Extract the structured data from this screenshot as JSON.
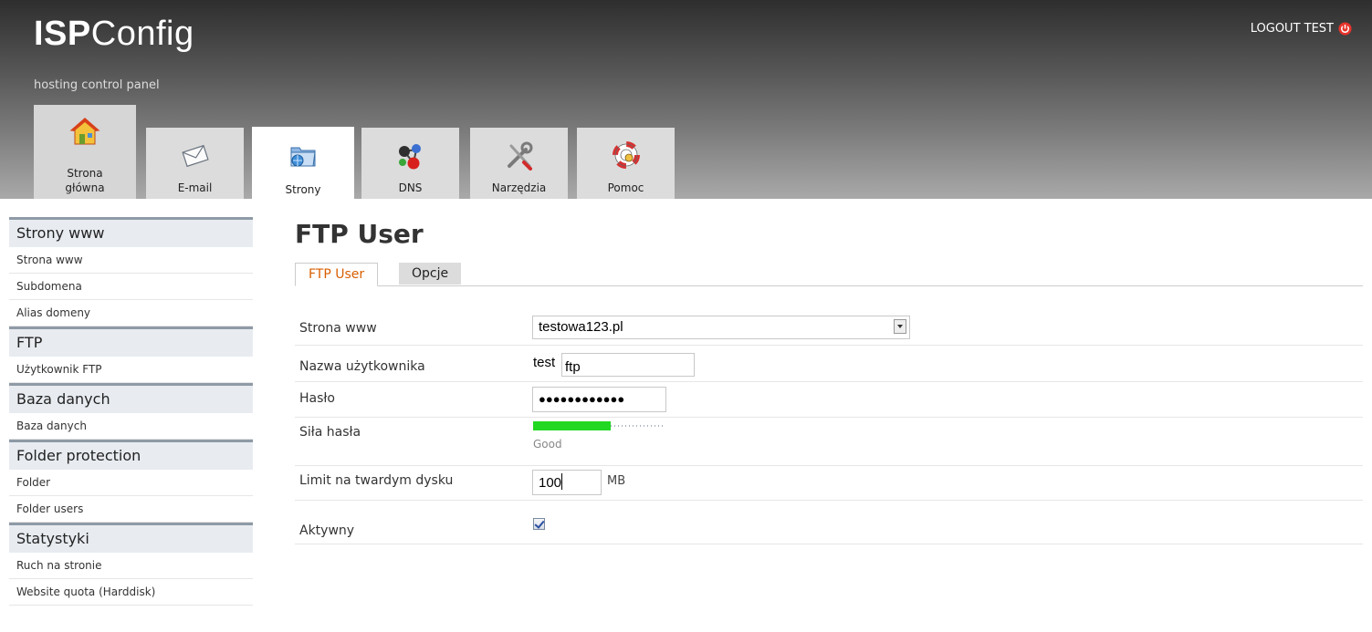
{
  "header": {
    "logo_bold": "ISP",
    "logo_rest": "Config",
    "tagline": "hosting control panel",
    "logout_label": "LOGOUT TEST"
  },
  "nav_tabs": [
    {
      "label_line1": "Strona",
      "label_line2": "główna",
      "icon": "home-icon"
    },
    {
      "label": "E-mail",
      "icon": "envelope-icon"
    },
    {
      "label": "Strony",
      "icon": "web-folder-icon",
      "active": true
    },
    {
      "label": "DNS",
      "icon": "dns-network-icon"
    },
    {
      "label": "Narzędzia",
      "icon": "tools-icon"
    },
    {
      "label": "Pomoc",
      "icon": "lifebuoy-icon"
    }
  ],
  "sidebar": {
    "sections": [
      {
        "title": "Strony www",
        "items": [
          "Strona www",
          "Subdomena",
          "Alias domeny"
        ]
      },
      {
        "title": "FTP",
        "items": [
          "Użytkownik FTP"
        ]
      },
      {
        "title": "Baza danych",
        "items": [
          "Baza danych"
        ]
      },
      {
        "title": "Folder protection",
        "items": [
          "Folder",
          "Folder users"
        ]
      },
      {
        "title": "Statystyki",
        "items": [
          "Ruch na stronie",
          "Website quota (Harddisk)"
        ]
      }
    ]
  },
  "content": {
    "title": "FTP User",
    "tabs": [
      "FTP User",
      "Opcje"
    ],
    "form": {
      "website_label": "Strona www",
      "website_value": "testowa123.pl",
      "username_label": "Nazwa użytkownika",
      "username_prefix": "test",
      "username_value": "ftp",
      "password_label": "Hasło",
      "password_value": "●●●●●●●●●●●●",
      "strength_label": "Siła hasła",
      "strength_fraction": 0.6,
      "strength_text": "Good",
      "quota_label": "Limit na twardym dysku",
      "quota_value": "100",
      "quota_unit": "MB",
      "active_label": "Aktywny",
      "active_checked": true
    }
  },
  "colors": {
    "active_tab_text": "#d85e00",
    "strength_good": "#22d822",
    "section_border": "#8e9aa6"
  }
}
